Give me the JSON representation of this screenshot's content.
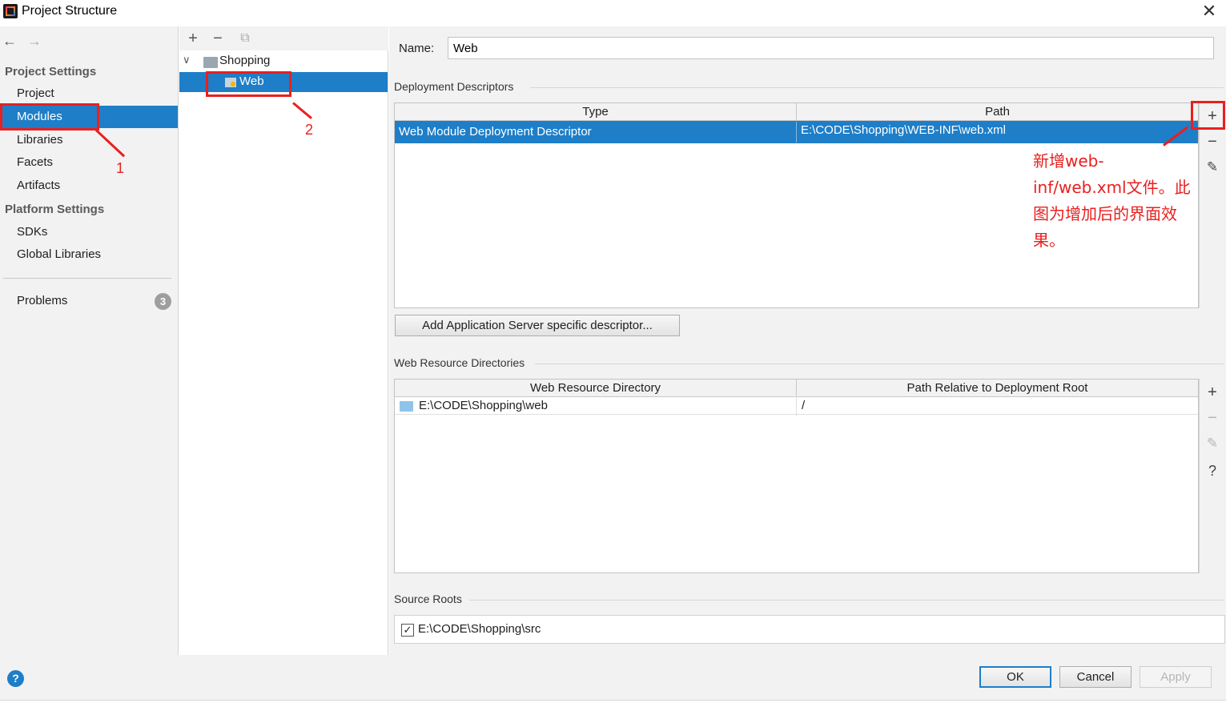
{
  "window": {
    "title": "Project Structure"
  },
  "nav": {
    "project_settings_header": "Project Settings",
    "project_settings_items": [
      {
        "label": "Project"
      },
      {
        "label": "Modules"
      },
      {
        "label": "Libraries"
      },
      {
        "label": "Facets"
      },
      {
        "label": "Artifacts"
      }
    ],
    "platform_settings_header": "Platform Settings",
    "platform_settings_items": [
      {
        "label": "SDKs"
      },
      {
        "label": "Global Libraries"
      }
    ],
    "problems_label": "Problems",
    "problems_count": "3",
    "selected": "Modules"
  },
  "tree": {
    "toolbar": {
      "add": "+",
      "remove": "−"
    },
    "root": "Shopping",
    "child": "Web"
  },
  "content": {
    "name_label": "Name:",
    "name_value": "Web",
    "deployment_descriptors": {
      "title": "Deployment Descriptors",
      "columns": [
        "Type",
        "Path"
      ],
      "rows": [
        {
          "type": "Web Module Deployment Descriptor",
          "path": "E:\\CODE\\Shopping\\WEB-INF\\web.xml"
        }
      ],
      "add_server_button": "Add Application Server specific descriptor..."
    },
    "web_resource_directories": {
      "title": "Web Resource Directories",
      "columns": [
        "Web Resource Directory",
        "Path Relative to Deployment Root"
      ],
      "rows": [
        {
          "directory": "E:\\CODE\\Shopping\\web",
          "relative_path": "/"
        }
      ]
    },
    "source_roots": {
      "title": "Source Roots",
      "items": [
        {
          "path": "E:\\CODE\\Shopping\\src",
          "checked": true
        }
      ]
    }
  },
  "buttons": {
    "ok": "OK",
    "cancel": "Cancel",
    "apply": "Apply"
  },
  "annotations": {
    "marker_1": "1",
    "marker_2": "2",
    "note": "新增web-inf/web.xml文件。此图为增加后的界面效果。",
    "color": "#e8201f"
  },
  "colors": {
    "selection": "#1e7ec8",
    "panel_bg": "#f2f2f2"
  }
}
